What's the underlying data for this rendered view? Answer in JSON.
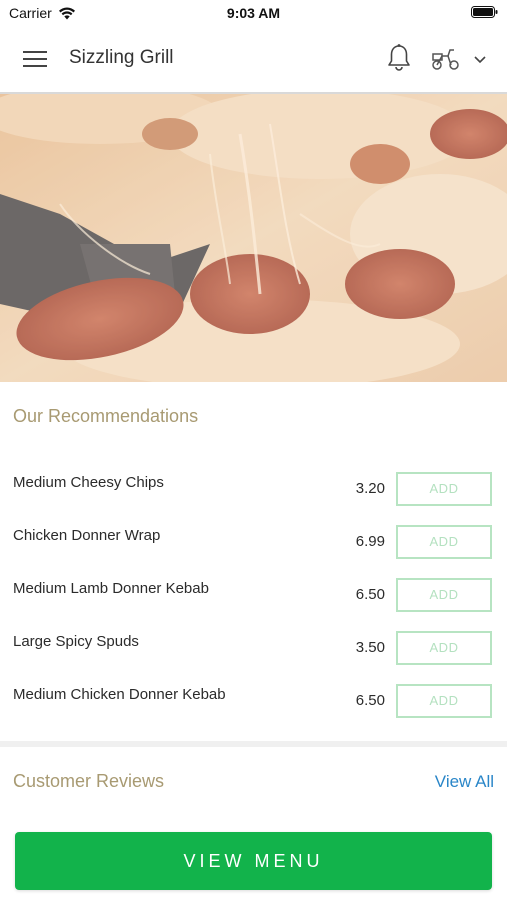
{
  "status_bar": {
    "carrier": "Carrier",
    "time": "9:03 AM"
  },
  "header": {
    "title": "Sizzling Grill",
    "icons": [
      "menu-icon",
      "bell-icon",
      "scooter-icon",
      "chevron-down-icon"
    ]
  },
  "hero": {
    "image": "pizza-photo"
  },
  "recommendations": {
    "title": "Our Recommendations",
    "add_label": "ADD",
    "items": [
      {
        "name": "Medium Cheesy Chips",
        "price": "3.20"
      },
      {
        "name": "Chicken Donner Wrap",
        "price": "6.99"
      },
      {
        "name": "Medium Lamb Donner Kebab",
        "price": "6.50"
      },
      {
        "name": "Large Spicy Spuds",
        "price": "3.50"
      },
      {
        "name": "Medium Chicken Donner Kebab",
        "price": "6.50"
      }
    ]
  },
  "reviews": {
    "title": "Customer Reviews",
    "view_all": "View All"
  },
  "footer": {
    "view_menu": "VIEW MENU"
  },
  "colors": {
    "accent_green": "#12b34b",
    "section_title": "#a89a72",
    "link_blue": "#2a86c8",
    "add_border": "#b7e4c2"
  }
}
